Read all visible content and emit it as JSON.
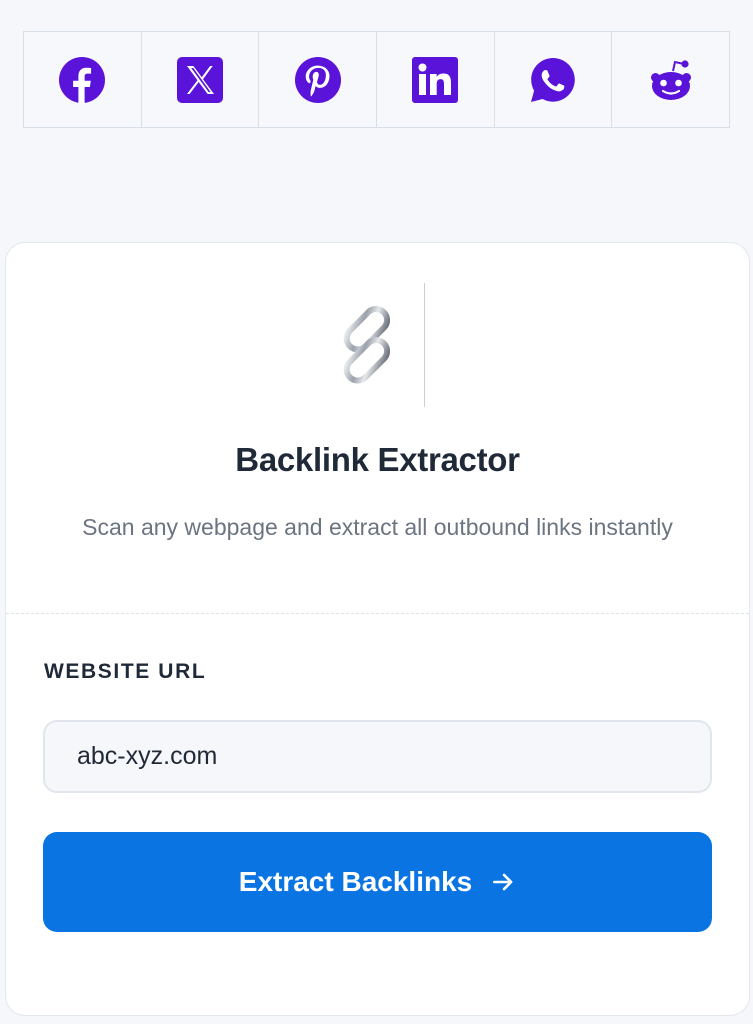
{
  "share_bar": {
    "brand_color": "#5a13d8",
    "items": [
      {
        "icon": "facebook-icon"
      },
      {
        "icon": "x-twitter-icon"
      },
      {
        "icon": "pinterest-icon"
      },
      {
        "icon": "linkedin-icon"
      },
      {
        "icon": "whatsapp-icon"
      },
      {
        "icon": "reddit-icon"
      }
    ]
  },
  "tool": {
    "image_icon": "chain-link-icon",
    "title": "Backlink Extractor",
    "subtitle": "Scan any webpage and extract all outbound links instantly"
  },
  "form": {
    "url_label": "WEBSITE URL",
    "url_value": "abc-xyz.com",
    "submit_label": "Extract Backlinks",
    "submit_icon": "arrow-right-icon",
    "submit_color": "#0a74e2"
  }
}
